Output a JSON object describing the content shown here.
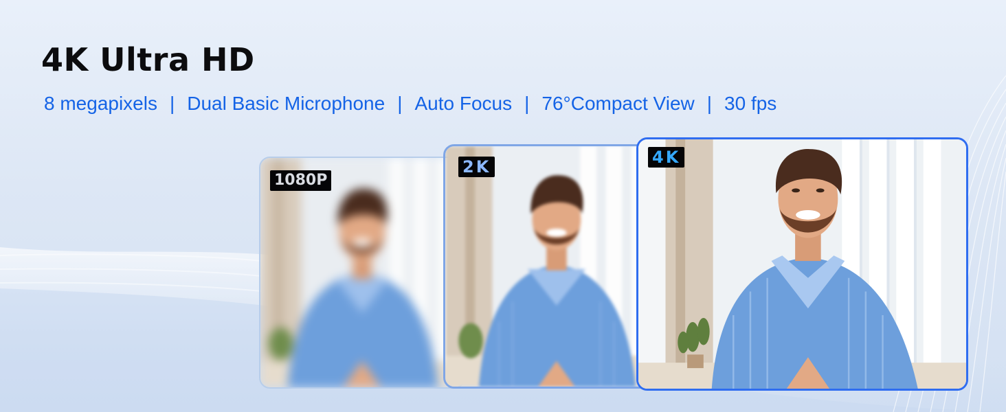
{
  "headline": "4K Ultra HD",
  "features": [
    "8 megapixels",
    "Dual Basic Microphone",
    "Auto Focus",
    "76°Compact View",
    "30 fps"
  ],
  "separator": "|",
  "cards": [
    {
      "badge": "1080P"
    },
    {
      "badge": "2K"
    },
    {
      "badge": "4K"
    }
  ],
  "colors": {
    "accent": "#1463e6",
    "title": "#0c0c0e",
    "highlight_border": "#2f6df0",
    "shirt": "#6d9fdc"
  },
  "icons": [
    "person-photo"
  ]
}
